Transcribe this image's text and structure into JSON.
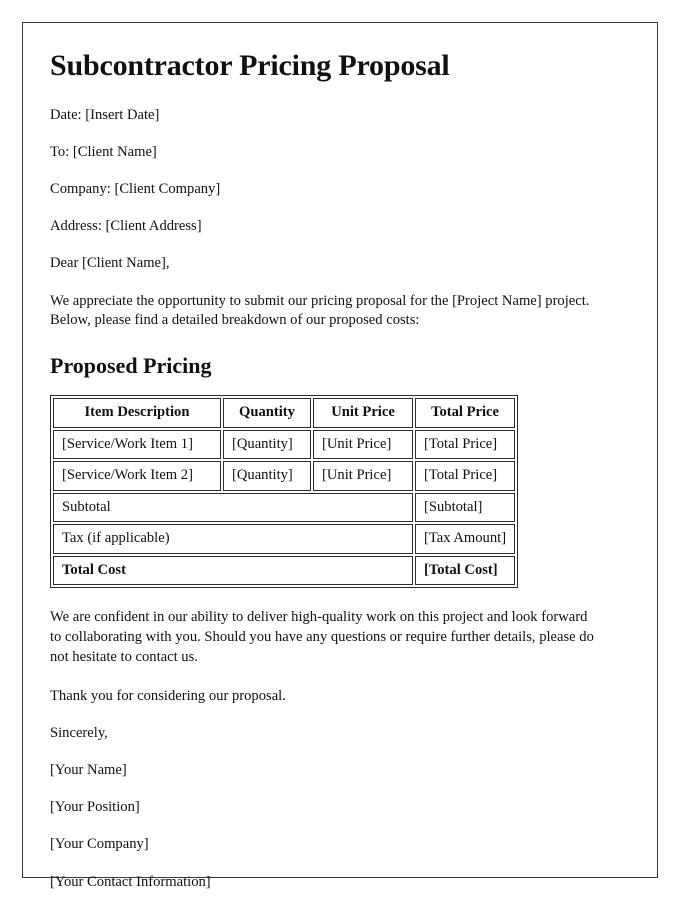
{
  "document": {
    "title": "Subcontractor Pricing Proposal",
    "meta_lines": [
      "Date: [Insert Date]",
      "To: [Client Name]",
      "Company: [Client Company]",
      "Address: [Client Address]"
    ],
    "salutation": "Dear [Client Name],",
    "intro_paragraph": "We appreciate the opportunity to submit our pricing proposal for the [Project Name] project. Below, please find a detailed breakdown of our proposed costs:",
    "section_heading": "Proposed Pricing",
    "pricing_table": {
      "headers": [
        "Item Description",
        "Quantity",
        "Unit Price",
        "Total Price"
      ],
      "rows": [
        [
          "[Service/Work Item 1]",
          "[Quantity]",
          "[Unit Price]",
          "[Total Price]"
        ],
        [
          "[Service/Work Item 2]",
          "[Quantity]",
          "[Unit Price]",
          "[Total Price]"
        ]
      ],
      "summary_rows": [
        {
          "label": "Subtotal",
          "value": "[Subtotal]",
          "bold": false
        },
        {
          "label": "Tax (if applicable)",
          "value": "[Tax Amount]",
          "bold": false
        },
        {
          "label": "Total Cost",
          "value": "[Total Cost]",
          "bold": true
        }
      ]
    },
    "closing_paragraph": "We are confident in our ability to deliver high-quality work on this project and look forward to collaborating with you. Should you have any questions or require further details, please do not hesitate to contact us.",
    "thank_you": "Thank you for considering our proposal.",
    "sign_off": "Sincerely,",
    "signature_lines": [
      "[Your Name]",
      "[Your Position]",
      "[Your Company]",
      "[Your Contact Information]"
    ]
  }
}
